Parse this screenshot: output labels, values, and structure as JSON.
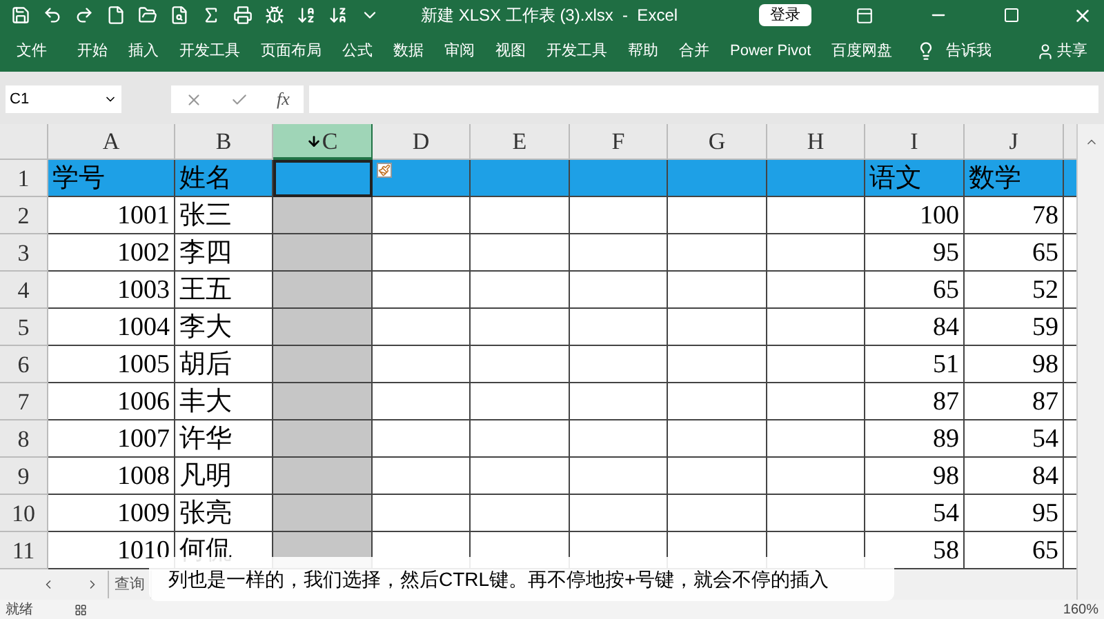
{
  "title_bar": {
    "title": "新建 XLSX 工作表 (3).xlsx  -  Excel",
    "login_button": "登录"
  },
  "ribbon_tabs": [
    "文件",
    "开始",
    "插入",
    "开发工具",
    "页面布局",
    "公式",
    "数据",
    "审阅",
    "视图",
    "开发工具",
    "帮助",
    "合并",
    "Power Pivot",
    "百度网盘"
  ],
  "tell_me": "告诉我",
  "share": "共享",
  "formula_bar": {
    "name_box": "C1",
    "fx": "fx"
  },
  "columns": [
    {
      "label": "A",
      "selected": false
    },
    {
      "label": "B",
      "selected": false
    },
    {
      "label": "C",
      "selected": true
    },
    {
      "label": "D",
      "selected": false
    },
    {
      "label": "E",
      "selected": false
    },
    {
      "label": "F",
      "selected": false
    },
    {
      "label": "G",
      "selected": false
    },
    {
      "label": "H",
      "selected": false
    },
    {
      "label": "I",
      "selected": false
    },
    {
      "label": "J",
      "selected": false
    }
  ],
  "header_row": {
    "number": "1",
    "a": "学号",
    "b": "姓名",
    "i": "语文",
    "j": "数学"
  },
  "data_rows": [
    {
      "number": "2",
      "a": "1001",
      "b": "张三",
      "i": "100",
      "j": "78"
    },
    {
      "number": "3",
      "a": "1002",
      "b": "李四",
      "i": "95",
      "j": "65"
    },
    {
      "number": "4",
      "a": "1003",
      "b": "王五",
      "i": "65",
      "j": "52"
    },
    {
      "number": "5",
      "a": "1004",
      "b": "李大",
      "i": "84",
      "j": "59"
    },
    {
      "number": "6",
      "a": "1005",
      "b": "胡后",
      "i": "51",
      "j": "98"
    },
    {
      "number": "7",
      "a": "1006",
      "b": "丰大",
      "i": "87",
      "j": "87"
    },
    {
      "number": "8",
      "a": "1007",
      "b": "许华",
      "i": "89",
      "j": "54"
    },
    {
      "number": "9",
      "a": "1008",
      "b": "凡明",
      "i": "98",
      "j": "84"
    },
    {
      "number": "10",
      "a": "1009",
      "b": "张亮",
      "i": "54",
      "j": "95"
    },
    {
      "number": "11",
      "a": "1010",
      "b": "何侃",
      "i": "58",
      "j": "65"
    }
  ],
  "sheet_tabs": [
    {
      "label": "查询"
    }
  ],
  "status_bar": {
    "status": "就绪",
    "zoom": "160%"
  },
  "subtitle": "列也是一样的，我们选择，然后CTRL键。再不停地按+号键，就会不停的插入"
}
